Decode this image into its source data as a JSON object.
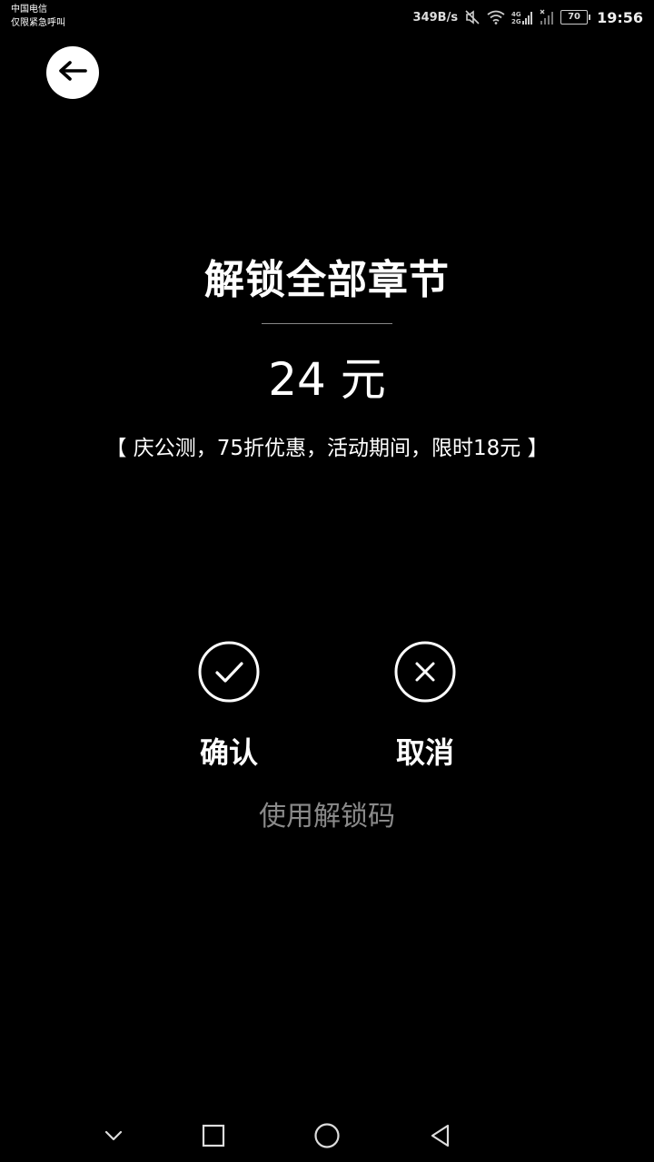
{
  "status_bar": {
    "carrier_line1": "中国电信",
    "carrier_line2": "仅限紧急呼叫",
    "net_speed": "349B/s",
    "battery_level": "70",
    "time": "19:56",
    "icons": [
      "mute-icon",
      "wifi-icon",
      "signal-4g-icon",
      "signal-icon",
      "battery-icon"
    ]
  },
  "header": {
    "back_icon": "arrow-left-icon"
  },
  "main": {
    "title": "解锁全部章节",
    "price": "24 元",
    "promo": "【 庆公测，75折优惠，活动期间，限时18元 】"
  },
  "actions": {
    "confirm_label": "确认",
    "confirm_icon": "check-icon",
    "cancel_label": "取消",
    "cancel_icon": "x-icon",
    "unlock_code_label": "使用解锁码"
  },
  "nav_bar": {
    "icons": [
      "chevron-down-icon",
      "recents-square-icon",
      "home-circle-icon",
      "back-triangle-icon"
    ]
  },
  "colors": {
    "background": "#000000",
    "text": "#ffffff",
    "muted_text": "#8a8a8a"
  }
}
